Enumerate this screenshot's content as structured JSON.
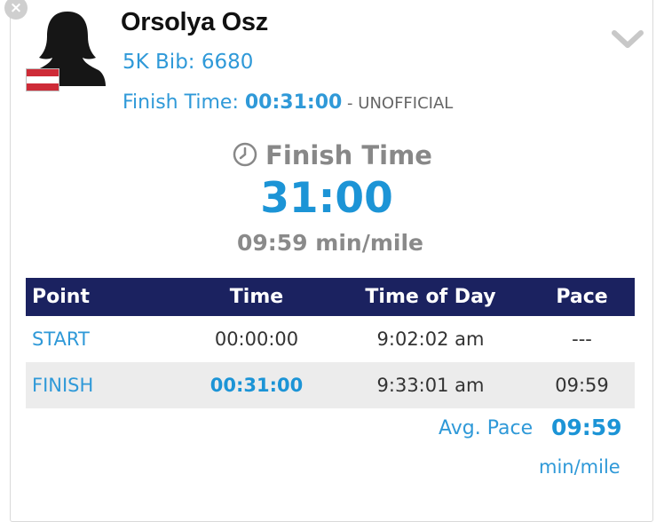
{
  "athlete": {
    "name": "Orsolya Osz",
    "bib_label": "5K Bib: 6680",
    "finish_label": "Finish Time:",
    "finish_value": "00:31:00",
    "finish_status": " - UNOFFICIAL",
    "flag_colors": [
      "#ce2b37",
      "#ffffff",
      "#ce2b37"
    ]
  },
  "summary": {
    "heading": "Finish Time",
    "big_time": "31:00",
    "pace_text": "09:59 min/mile"
  },
  "table": {
    "headers": [
      "Point",
      "Time",
      "Time of Day",
      "Pace"
    ],
    "rows": [
      {
        "point": "START",
        "time": "00:00:00",
        "tod": "9:02:02 am",
        "pace": "---"
      },
      {
        "point": "FINISH",
        "time": "00:31:00",
        "tod": "9:33:01 am",
        "pace": "09:59"
      }
    ]
  },
  "avg": {
    "label": "Avg. Pace",
    "value": "09:59",
    "unit": "min/mile"
  },
  "icons": {
    "close": "close-icon",
    "expand": "chevron-down-icon",
    "clock": "clock-icon",
    "avatar": "avatar-silhouette-icon"
  },
  "colors": {
    "accent": "#1c94d6",
    "header_bg": "#1b2260",
    "muted": "#888888"
  }
}
